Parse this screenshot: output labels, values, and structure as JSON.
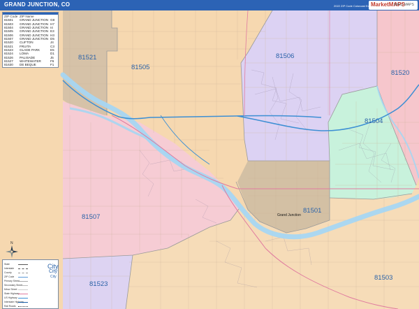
{
  "header": {
    "title": "GRAND JUNCTION, CO",
    "edition": "2022 ZIP Code Colorcast Edition",
    "brand_main": "MarketMAPS",
    "brand_sub": "WALL MAPS"
  },
  "legend": {
    "columns": [
      "ZIP Code",
      "ZIP Name",
      ""
    ],
    "rows": [
      {
        "zip": "81501",
        "name": "GRAND JUNCTION",
        "grid": "G8"
      },
      {
        "zip": "81503",
        "name": "GRAND JUNCTION",
        "grid": "H7"
      },
      {
        "zip": "81504",
        "name": "GRAND JUNCTION",
        "grid": "I4"
      },
      {
        "zip": "81505",
        "name": "GRAND JUNCTION",
        "grid": "E3"
      },
      {
        "zip": "81506",
        "name": "GRAND JUNCTION",
        "grid": "H3"
      },
      {
        "zip": "81507",
        "name": "GRAND JUNCTION",
        "grid": "D5"
      },
      {
        "zip": "81520",
        "name": "CLIFTON",
        "grid": "J4"
      },
      {
        "zip": "81521",
        "name": "FRUITA",
        "grid": "C3"
      },
      {
        "zip": "81523",
        "name": "GLADE PARK",
        "grid": "E5"
      },
      {
        "zip": "81524",
        "name": "LOMA",
        "grid": "D1"
      },
      {
        "zip": "81526",
        "name": "PALISADE",
        "grid": "J5"
      },
      {
        "zip": "81527",
        "name": "WHITEWATER",
        "grid": "F6"
      },
      {
        "zip": "81630",
        "name": "DE BEQUE",
        "grid": "F1"
      }
    ]
  },
  "map": {
    "zip_labels": [
      "81521",
      "81505",
      "81506",
      "81520",
      "81504",
      "81501",
      "81507",
      "81523",
      "81503"
    ],
    "place_labels": [
      "Grand Junction"
    ],
    "colors": {
      "81505": "#f6d8b0",
      "81521": "#d6c2a8",
      "81506": "#dcd2f3",
      "81520": "#f6c6cc",
      "81504": "#c8f2dc",
      "81501": "#d3c0a4",
      "81507": "#f6ccd4",
      "81523": "#ddd3f2",
      "81503": "#f6dcb8",
      "water": "#a6d6f2",
      "highway": "#3d8fd4",
      "road": "#e07b9f"
    }
  },
  "key": {
    "items": [
      "State",
      "Interstate",
      "County",
      "ZIP Code",
      "Primary Street",
      "Secondary Street",
      "Minor Street",
      "State Highway",
      "US Highway",
      "Interstate Highway",
      "Rail Roads"
    ],
    "city_big": "City",
    "city_mid": "City",
    "city_small": "City",
    "north_label": "N"
  }
}
